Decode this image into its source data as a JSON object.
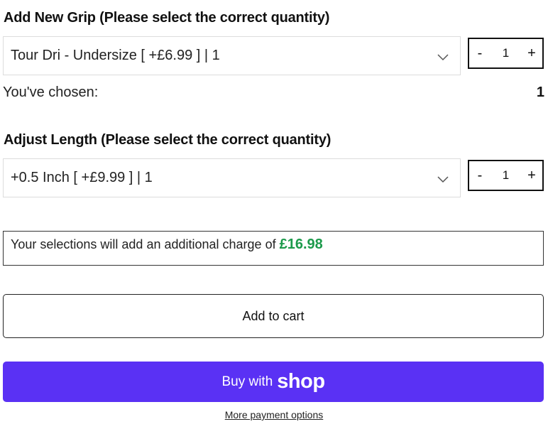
{
  "grip": {
    "title": "Add New Grip (Please select the correct quantity)",
    "selected": "Tour Dri - Undersize [ +£6.99 ] | 1",
    "qty_minus": "-",
    "qty_value": "1",
    "qty_plus": "+",
    "chosen_label": "You've chosen:",
    "chosen_count": "1"
  },
  "length": {
    "title": "Adjust Length (Please select the correct quantity)",
    "selected": "+0.5 Inch [ +£9.99 ] | 1",
    "qty_minus": "-",
    "qty_value": "1",
    "qty_plus": "+"
  },
  "charge": {
    "text": "Your selections will add an additional charge of ",
    "amount": "£16.98",
    "amount_color": "#1c9a4b"
  },
  "actions": {
    "add_to_cart": "Add to cart",
    "buy_with": "Buy with",
    "shop_logo": "shop",
    "buy_button_color": "#5a31f4",
    "more_payment": "More payment options"
  },
  "icons": {
    "select_chevron": "chevron-down-icon"
  }
}
